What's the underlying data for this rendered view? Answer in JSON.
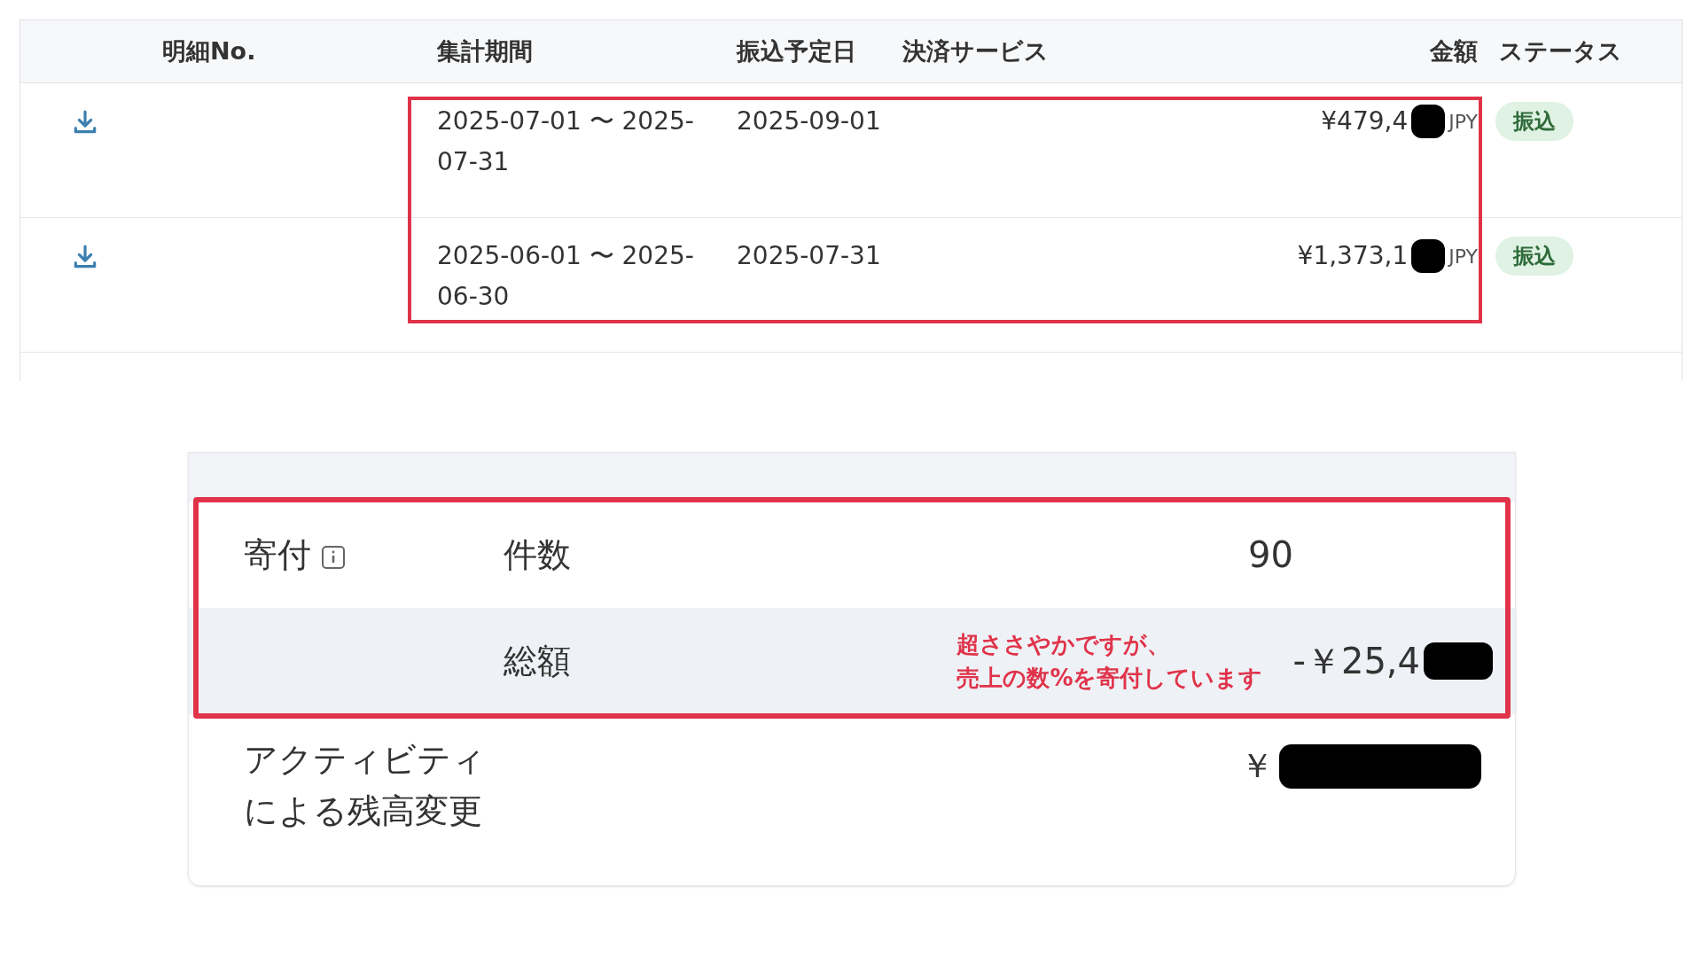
{
  "table": {
    "highlighted": true,
    "columns": [
      "",
      "明細No.",
      "集計期間",
      "振込予定日",
      "決済サービス",
      "金額",
      "ステータス"
    ],
    "rows": [
      {
        "period_lines": [
          "2025-07-01 〜 2025-",
          "07-31"
        ],
        "transfer_date": "2025-09-01",
        "amount": "¥479,4",
        "currency": "JPY",
        "status": "振込"
      },
      {
        "period_lines": [
          "2025-06-01 〜 2025-",
          "06-30"
        ],
        "transfer_date": "2025-07-31",
        "amount": "¥1,373,1",
        "currency": "JPY",
        "status": "振込"
      }
    ]
  },
  "donation": {
    "highlighted": true,
    "label": "寄付",
    "rows": [
      {
        "label": "件数",
        "value": "90",
        "shaded": false
      },
      {
        "label": "総額",
        "value": "-￥25,4",
        "shaded": true
      }
    ],
    "annotation_lines": [
      "超ささやかですが、",
      "売上の数%を寄付しています"
    ]
  },
  "activity": {
    "label_lines": [
      "アクティビティ",
      "による残高変更"
    ],
    "value": "￥"
  }
}
